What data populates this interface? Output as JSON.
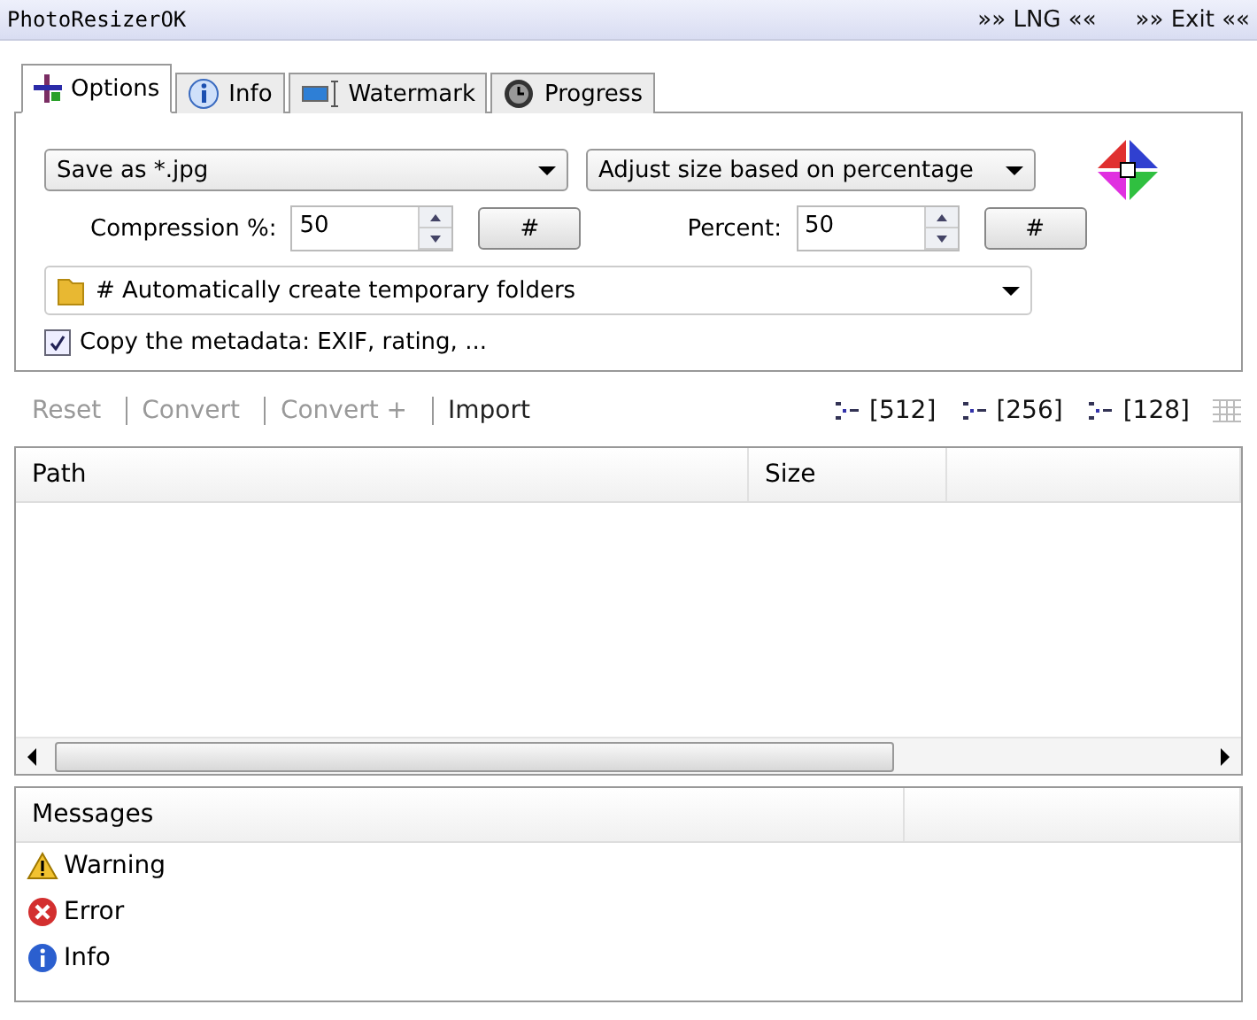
{
  "window": {
    "title": "PhotoResizerOK",
    "menu": [
      {
        "label": "»» LNG ««"
      },
      {
        "label": "»» Exit ««"
      }
    ]
  },
  "tabs": [
    {
      "label": "Options",
      "kind": "options",
      "selected": true
    },
    {
      "label": "Info",
      "kind": "info",
      "selected": false
    },
    {
      "label": "Watermark",
      "kind": "watermark",
      "selected": false
    },
    {
      "label": "Progress",
      "kind": "progress",
      "selected": false
    }
  ],
  "options": {
    "format": "Save as *.jpg",
    "resize_mode": "Adjust size based on percentage",
    "compression": {
      "label": "Compression %:",
      "value": "50",
      "button": "#"
    },
    "percent": {
      "label": "Percent:",
      "value": "50",
      "button": "#"
    },
    "folder": "# Automatically create temporary folders",
    "metadata": {
      "label": "Copy the metadata: EXIF, rating, ...",
      "checked": true
    }
  },
  "toolbar": {
    "actions": [
      {
        "label": "Reset",
        "disabled": true
      },
      {
        "label": "Convert",
        "disabled": true
      },
      {
        "label": "Convert +",
        "disabled": true
      },
      {
        "label": "Import",
        "disabled": false
      }
    ],
    "presets": [
      "[512]",
      "[256]",
      "[128]"
    ]
  },
  "table": {
    "columns": [
      "Path",
      "Size"
    ]
  },
  "messages": {
    "title": "Messages",
    "items": [
      {
        "label": "Warning",
        "kind": "warning"
      },
      {
        "label": "Error",
        "kind": "error"
      },
      {
        "label": "Info",
        "kind": "info"
      }
    ]
  }
}
